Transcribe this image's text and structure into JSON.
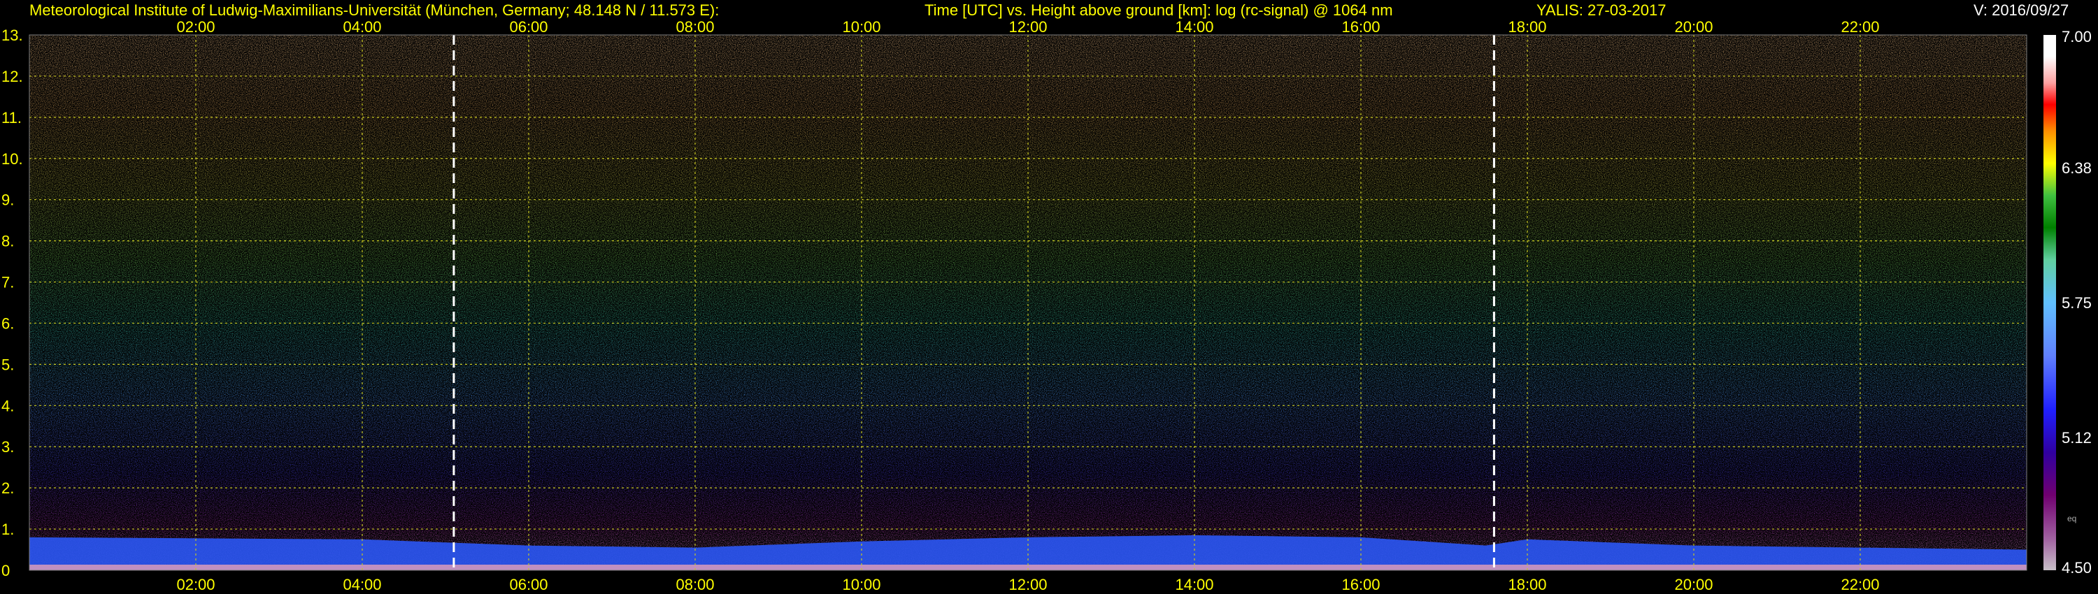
{
  "header": {
    "institute": "Meteorological Institute of Ludwig-Maximilians-Universität (München, Germany; 48.148 N / 11.573 E):",
    "plot_description": "Time [UTC] vs. Height above ground [km]: log (rc-signal) @ 1064 nm",
    "instrument_date": "YALIS: 27-03-2017",
    "version": "V: 2016/09/27"
  },
  "colors": {
    "header_text": "#ffff00",
    "grid": "#c8c820",
    "marker_line": "#ffffff",
    "background": "#000000"
  },
  "chart_data": {
    "type": "heatmap",
    "title": "Time [UTC] vs. Height above ground [km]: log (rc-signal) @ 1064 nm",
    "x_ticks": [
      "02:00",
      "04:00",
      "06:00",
      "08:00",
      "10:00",
      "12:00",
      "14:00",
      "16:00",
      "18:00",
      "20:00",
      "22:00"
    ],
    "x_tick_hours": [
      2,
      4,
      6,
      8,
      10,
      12,
      14,
      16,
      18,
      20,
      22
    ],
    "x_range_hours": [
      0,
      24
    ],
    "y_ticks": [
      "0",
      "1.",
      "2.",
      "3.",
      "4.",
      "5.",
      "6.",
      "7.",
      "8.",
      "9.",
      "10.",
      "11.",
      "12.",
      "13."
    ],
    "y_tick_values": [
      0,
      1,
      2,
      3,
      4,
      5,
      6,
      7,
      8,
      9,
      10,
      11,
      12,
      13
    ],
    "y_range_km": [
      0,
      13
    ],
    "grid": true,
    "vertical_markers_hours": [
      5.1,
      17.6
    ],
    "colorbar": {
      "range": [
        4.5,
        7.0
      ],
      "labels": [
        "7.00",
        "6.38",
        "5.75",
        "5.12",
        "4.50"
      ],
      "label_values": [
        7.0,
        6.38,
        5.75,
        5.12,
        4.5
      ],
      "extra_label": "eq"
    },
    "boundary_layer_top_km": [
      {
        "t": 0,
        "h": 0.8
      },
      {
        "t": 4,
        "h": 0.75
      },
      {
        "t": 6,
        "h": 0.6
      },
      {
        "t": 8,
        "h": 0.55
      },
      {
        "t": 10,
        "h": 0.7
      },
      {
        "t": 12,
        "h": 0.8
      },
      {
        "t": 14,
        "h": 0.85
      },
      {
        "t": 16,
        "h": 0.8
      },
      {
        "t": 17.5,
        "h": 0.6
      },
      {
        "t": 18,
        "h": 0.75
      },
      {
        "t": 20,
        "h": 0.6
      },
      {
        "t": 24,
        "h": 0.5
      }
    ]
  }
}
